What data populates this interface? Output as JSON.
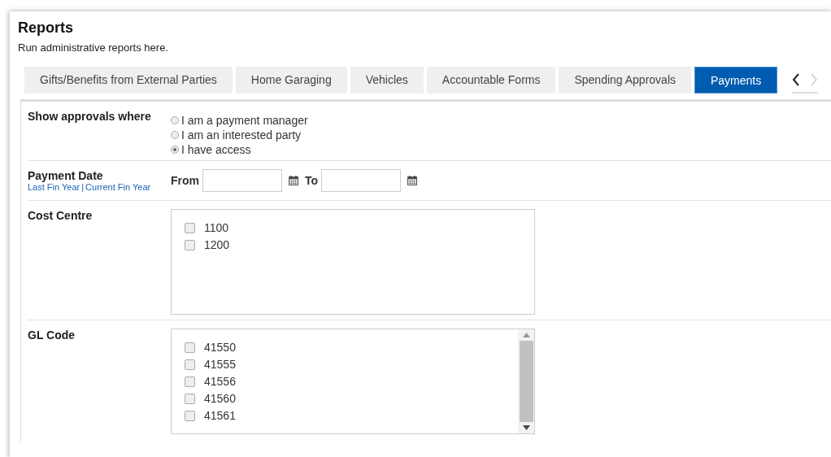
{
  "page": {
    "title": "Reports",
    "subtitle": "Run administrative reports here."
  },
  "tabs": [
    {
      "label": "Gifts/Benefits from External Parties",
      "selected": false
    },
    {
      "label": "Home Garaging",
      "selected": false
    },
    {
      "label": "Vehicles",
      "selected": false
    },
    {
      "label": "Accountable Forms",
      "selected": false
    },
    {
      "label": "Spending Approvals",
      "selected": false
    },
    {
      "label": "Payments",
      "selected": true
    }
  ],
  "filters": {
    "approvals": {
      "label": "Show approvals where",
      "options": [
        {
          "label": "I am a payment manager",
          "selected": false
        },
        {
          "label": "I am an interested party",
          "selected": false
        },
        {
          "label": "I have access",
          "selected": true
        }
      ]
    },
    "payment_date": {
      "label": "Payment Date",
      "links": [
        "Last Fin Year",
        "Current Fin Year"
      ],
      "link_separator": "|",
      "from_label": "From",
      "to_label": "To"
    },
    "cost_centre": {
      "label": "Cost Centre",
      "items": [
        {
          "label": "1100",
          "checked": false
        },
        {
          "label": "1200",
          "checked": false
        }
      ]
    },
    "gl_code": {
      "label": "GL Code",
      "items": [
        {
          "label": "41550",
          "checked": false
        },
        {
          "label": "41555",
          "checked": false
        },
        {
          "label": "41556",
          "checked": false
        },
        {
          "label": "41560",
          "checked": false
        },
        {
          "label": "41561",
          "checked": false
        }
      ]
    }
  }
}
